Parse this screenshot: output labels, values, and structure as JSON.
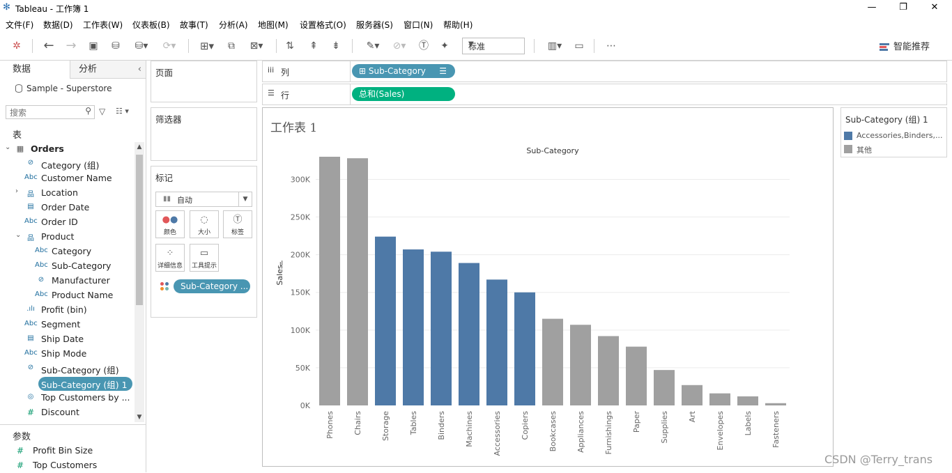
{
  "window": {
    "title": "Tableau - 工作簿 1",
    "buttons": {
      "minimize": "—",
      "restore": "❐",
      "close": "✕"
    }
  },
  "menu": [
    "文件(F)",
    "数据(D)",
    "工作表(W)",
    "仪表板(B)",
    "故事(T)",
    "分析(A)",
    "地图(M)",
    "设置格式(O)",
    "服务器(S)",
    "窗口(N)",
    "帮助(H)"
  ],
  "toolbar": {
    "fit_select": "标准",
    "smart_label": "智能推荐"
  },
  "left_pane": {
    "tab_data": "数据",
    "tab_analysis": "分析",
    "datasource": "Sample - Superstore",
    "search_placeholder": "搜索",
    "tables_header": "表",
    "fields": [
      {
        "name": "Orders",
        "icon": "table-icon",
        "level": 0,
        "bold": true,
        "toggle": "expanded"
      },
      {
        "name": "Category (组)",
        "icon": "paperclip-icon",
        "level": 1
      },
      {
        "name": "Customer Name",
        "icon": "abc-icon",
        "level": 1
      },
      {
        "name": "Location",
        "icon": "hierarchy-icon",
        "level": 1,
        "toggle": "collapsed"
      },
      {
        "name": "Order Date",
        "icon": "calendar-icon",
        "level": 1
      },
      {
        "name": "Order ID",
        "icon": "abc-icon",
        "level": 1
      },
      {
        "name": "Product",
        "icon": "hierarchy-icon",
        "level": 1,
        "toggle": "expanded"
      },
      {
        "name": "Category",
        "icon": "abc-icon",
        "level": 2
      },
      {
        "name": "Sub-Category",
        "icon": "abc-icon",
        "level": 2
      },
      {
        "name": "Manufacturer",
        "icon": "paperclip-icon",
        "level": 2
      },
      {
        "name": "Product Name",
        "icon": "abc-icon",
        "level": 2
      },
      {
        "name": "Profit (bin)",
        "icon": "bin-icon",
        "level": 1
      },
      {
        "name": "Segment",
        "icon": "abc-icon",
        "level": 1
      },
      {
        "name": "Ship Date",
        "icon": "calendar-icon",
        "level": 1
      },
      {
        "name": "Ship Mode",
        "icon": "abc-icon",
        "level": 1
      },
      {
        "name": "Sub-Category (组)",
        "icon": "paperclip-icon",
        "level": 1
      },
      {
        "name": "Sub-Category (组) 1",
        "icon": "paperclip-icon",
        "level": 1,
        "selected": true
      },
      {
        "name": "Top Customers by ...",
        "icon": "set-icon",
        "level": 1
      },
      {
        "name": "Discount",
        "icon": "measure-icon",
        "level": 1
      }
    ],
    "params_header": "参数",
    "params": [
      {
        "name": "Profit Bin Size",
        "icon": "measure-icon"
      },
      {
        "name": "Top Customers",
        "icon": "measure-icon"
      }
    ]
  },
  "cards": {
    "pages": "页面",
    "filters": "筛选器",
    "marks": "标记",
    "marks_type": "自动",
    "mark_buttons": [
      {
        "label": "颜色",
        "icon": "color-icon"
      },
      {
        "label": "大小",
        "icon": "size-icon"
      },
      {
        "label": "标签",
        "icon": "label-icon"
      },
      {
        "label": "详细信息",
        "icon": "detail-icon"
      },
      {
        "label": "工具提示",
        "icon": "tooltip-icon"
      }
    ],
    "marks_pill": "Sub-Category ..."
  },
  "shelves": {
    "columns_label": "列",
    "rows_label": "行",
    "columns_pill": "⊞ Sub-Category",
    "rows_pill": "总和(Sales)"
  },
  "sheet": {
    "title": "工作表 1"
  },
  "legend": {
    "title": "Sub-Category (组) 1",
    "items": [
      {
        "label": "Accessories,Binders,...",
        "color": "#4e79a7"
      },
      {
        "label": "其他",
        "color": "#a0a0a0"
      }
    ]
  },
  "colors": {
    "blue_bar": "#4e79a7",
    "gray_bar": "#a0a0a0",
    "pill_green": "#00b180",
    "pill_blue": "#4996b2"
  },
  "watermark": "CSDN @Terry_trans",
  "chart_data": {
    "type": "bar",
    "title": "Sub-Category",
    "xlabel": "",
    "ylabel": "Sales",
    "ylim": [
      0,
      330000
    ],
    "yticks": [
      0,
      50000,
      100000,
      150000,
      200000,
      250000,
      300000
    ],
    "ytick_labels": [
      "0K",
      "50K",
      "100K",
      "150K",
      "200K",
      "250K",
      "300K"
    ],
    "grid": true,
    "categories": [
      "Phones",
      "Chairs",
      "Storage",
      "Tables",
      "Binders",
      "Machines",
      "Accessories",
      "Copiers",
      "Bookcases",
      "Appliances",
      "Furnishings",
      "Paper",
      "Supplies",
      "Art",
      "Envelopes",
      "Labels",
      "Fasteners"
    ],
    "values": [
      330000,
      328000,
      224000,
      207000,
      204000,
      189000,
      167000,
      150000,
      115000,
      107000,
      92000,
      78000,
      47000,
      27000,
      16000,
      12000,
      3000
    ],
    "groups": [
      "其他",
      "其他",
      "Accessories,Binders,...",
      "Accessories,Binders,...",
      "Accessories,Binders,...",
      "Accessories,Binders,...",
      "Accessories,Binders,...",
      "Accessories,Binders,...",
      "其他",
      "其他",
      "其他",
      "其他",
      "其他",
      "其他",
      "其他",
      "其他",
      "其他"
    ]
  }
}
